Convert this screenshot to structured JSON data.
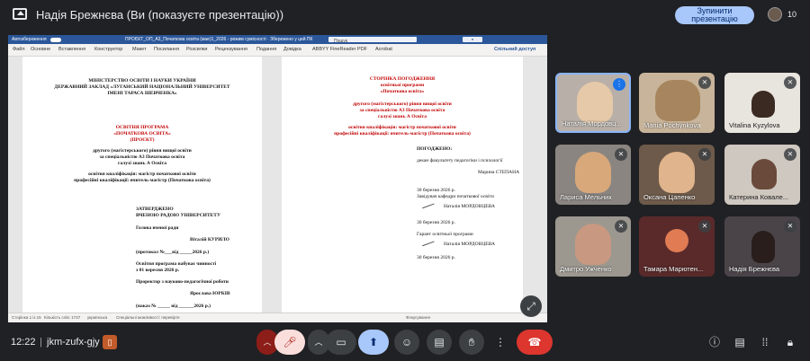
{
  "topbar": {
    "presenter_title": "Надія Брежнєва (Ви (показуєте презентацію))",
    "stop_line1": "Зупинити",
    "stop_line2": "презентацію",
    "participant_count": "10"
  },
  "word": {
    "autosave": "Автозбереження",
    "filename": "ПРОЄКТ_ОП_А3_Початкова освіта (мае)1_2026 - режим сумісності · Збережено у цей ПК",
    "search": "Пошук",
    "menu": [
      "Файл",
      "Основне",
      "Вставлення",
      "Конструктор",
      "Макет",
      "Посилання",
      "Розсилки",
      "Рецензування",
      "Подання",
      "Довідка",
      "ABBYY FineReader PDF",
      "Acrobat"
    ],
    "share": "Спільний доступ",
    "status_left": "Сторінка 1 із 15",
    "status_words": "Кількість слів: 1747",
    "status_lang": "українська",
    "status_access": "Спеціальні можливості: перевірте",
    "status_focus": "Фокусування"
  },
  "page1": {
    "l1": "МІНІСТЕРСТВО ОСВІТИ І НАУКИ УКРАЇНИ",
    "l2": "ДЕРЖАВНИЙ ЗАКЛАД «ЛУГАНСЬКИЙ НАЦІОНАЛЬНИЙ УНІВЕРСИТЕТ",
    "l3": "ІМЕНІ ТАРАСА ШЕВЧЕНКА»",
    "l4": "ОСВІТНЯ ПРОГРАМА",
    "l5": "«ПОЧАТКОВА ОСВІТА»",
    "l6": "(ПРОЄКТ)",
    "l7": "другого (магістерського) рівня вищої освіти",
    "l8": "за спеціальністю А3 Початкова освіта",
    "l9": "галузі знань А Освіта",
    "l10": "освітня кваліфікація: магістр початкової освіти",
    "l11": "професійні кваліфікації: вчитель-магістр (Початкова освіта)",
    "l12": "ЗАТВЕРДЖЕНО",
    "l13": "ВЧЕНОЮ РАДОЮ УНІВЕРСИТЕТУ",
    "l14": "Голова вченої ради",
    "l15": "Віталій КУРИЛО",
    "l16": "(протокол №___від _____2026 р.)",
    "l17": "Освітня програма набуває чинності",
    "l18": "з 01 вересня 2026 р.",
    "l19": "Проректор з науково-педагогічної роботи",
    "l20": "Ярослава ЮРКІВ",
    "l21": "(наказ № _____ від ______2026 р.)"
  },
  "page2": {
    "l1": "СТОРІНКА ПОГОДЖЕННЯ",
    "l2": "освітньої програми",
    "l3": "«Початкова освіта»",
    "l4": "другого (магістерського) рівня вищої освіти",
    "l5": "за спеціальністю А3 Початкова освіта",
    "l6": "галузі знань А Освіта",
    "l7": "освітня кваліфікація: магістр початкової освіти",
    "l8": "професійні кваліфікації: вчитель-магістр (Початкова освіта)",
    "l9": "ПОГОДЖЕНО:",
    "l10": "декан факультету педагогіки і психології",
    "l11": "Марина СТЕПАНА",
    "l12": "30 березня 2026 р.",
    "l13": "Завідувач кафедри початкової освіти",
    "l14": "Наталія МОРДОВЦЕВА",
    "l15": "30 березня 2026 р.",
    "l16": "Гарант освітньої програми",
    "l17": "Наталія МОРДОВЦЕВА",
    "l18": "30 березня 2026 р."
  },
  "participants": [
    {
      "name": "Наталія Мордовц...",
      "speaking": true
    },
    {
      "name": "Mariia Pochynkova",
      "speaking": false
    },
    {
      "name": "Vitalina Kyzylova",
      "speaking": false
    },
    {
      "name": "Лариса Мельник",
      "speaking": false
    },
    {
      "name": "Оксана Цапенко",
      "speaking": false
    },
    {
      "name": "Катерина Ковале...",
      "speaking": false
    },
    {
      "name": "Дмитро Ужченко",
      "speaking": false
    },
    {
      "name": "Тамара Марютен...",
      "speaking": false
    },
    {
      "name": "Надія Брежнєва",
      "speaking": false
    }
  ],
  "bottombar": {
    "time": "12:22",
    "separator": "|",
    "meeting_code": "jkm-zufx-gjy"
  },
  "colors": {
    "background": "#202124",
    "accent": "#a8c7fa",
    "hangup": "#dc362e",
    "word_blue": "#2b579a"
  }
}
